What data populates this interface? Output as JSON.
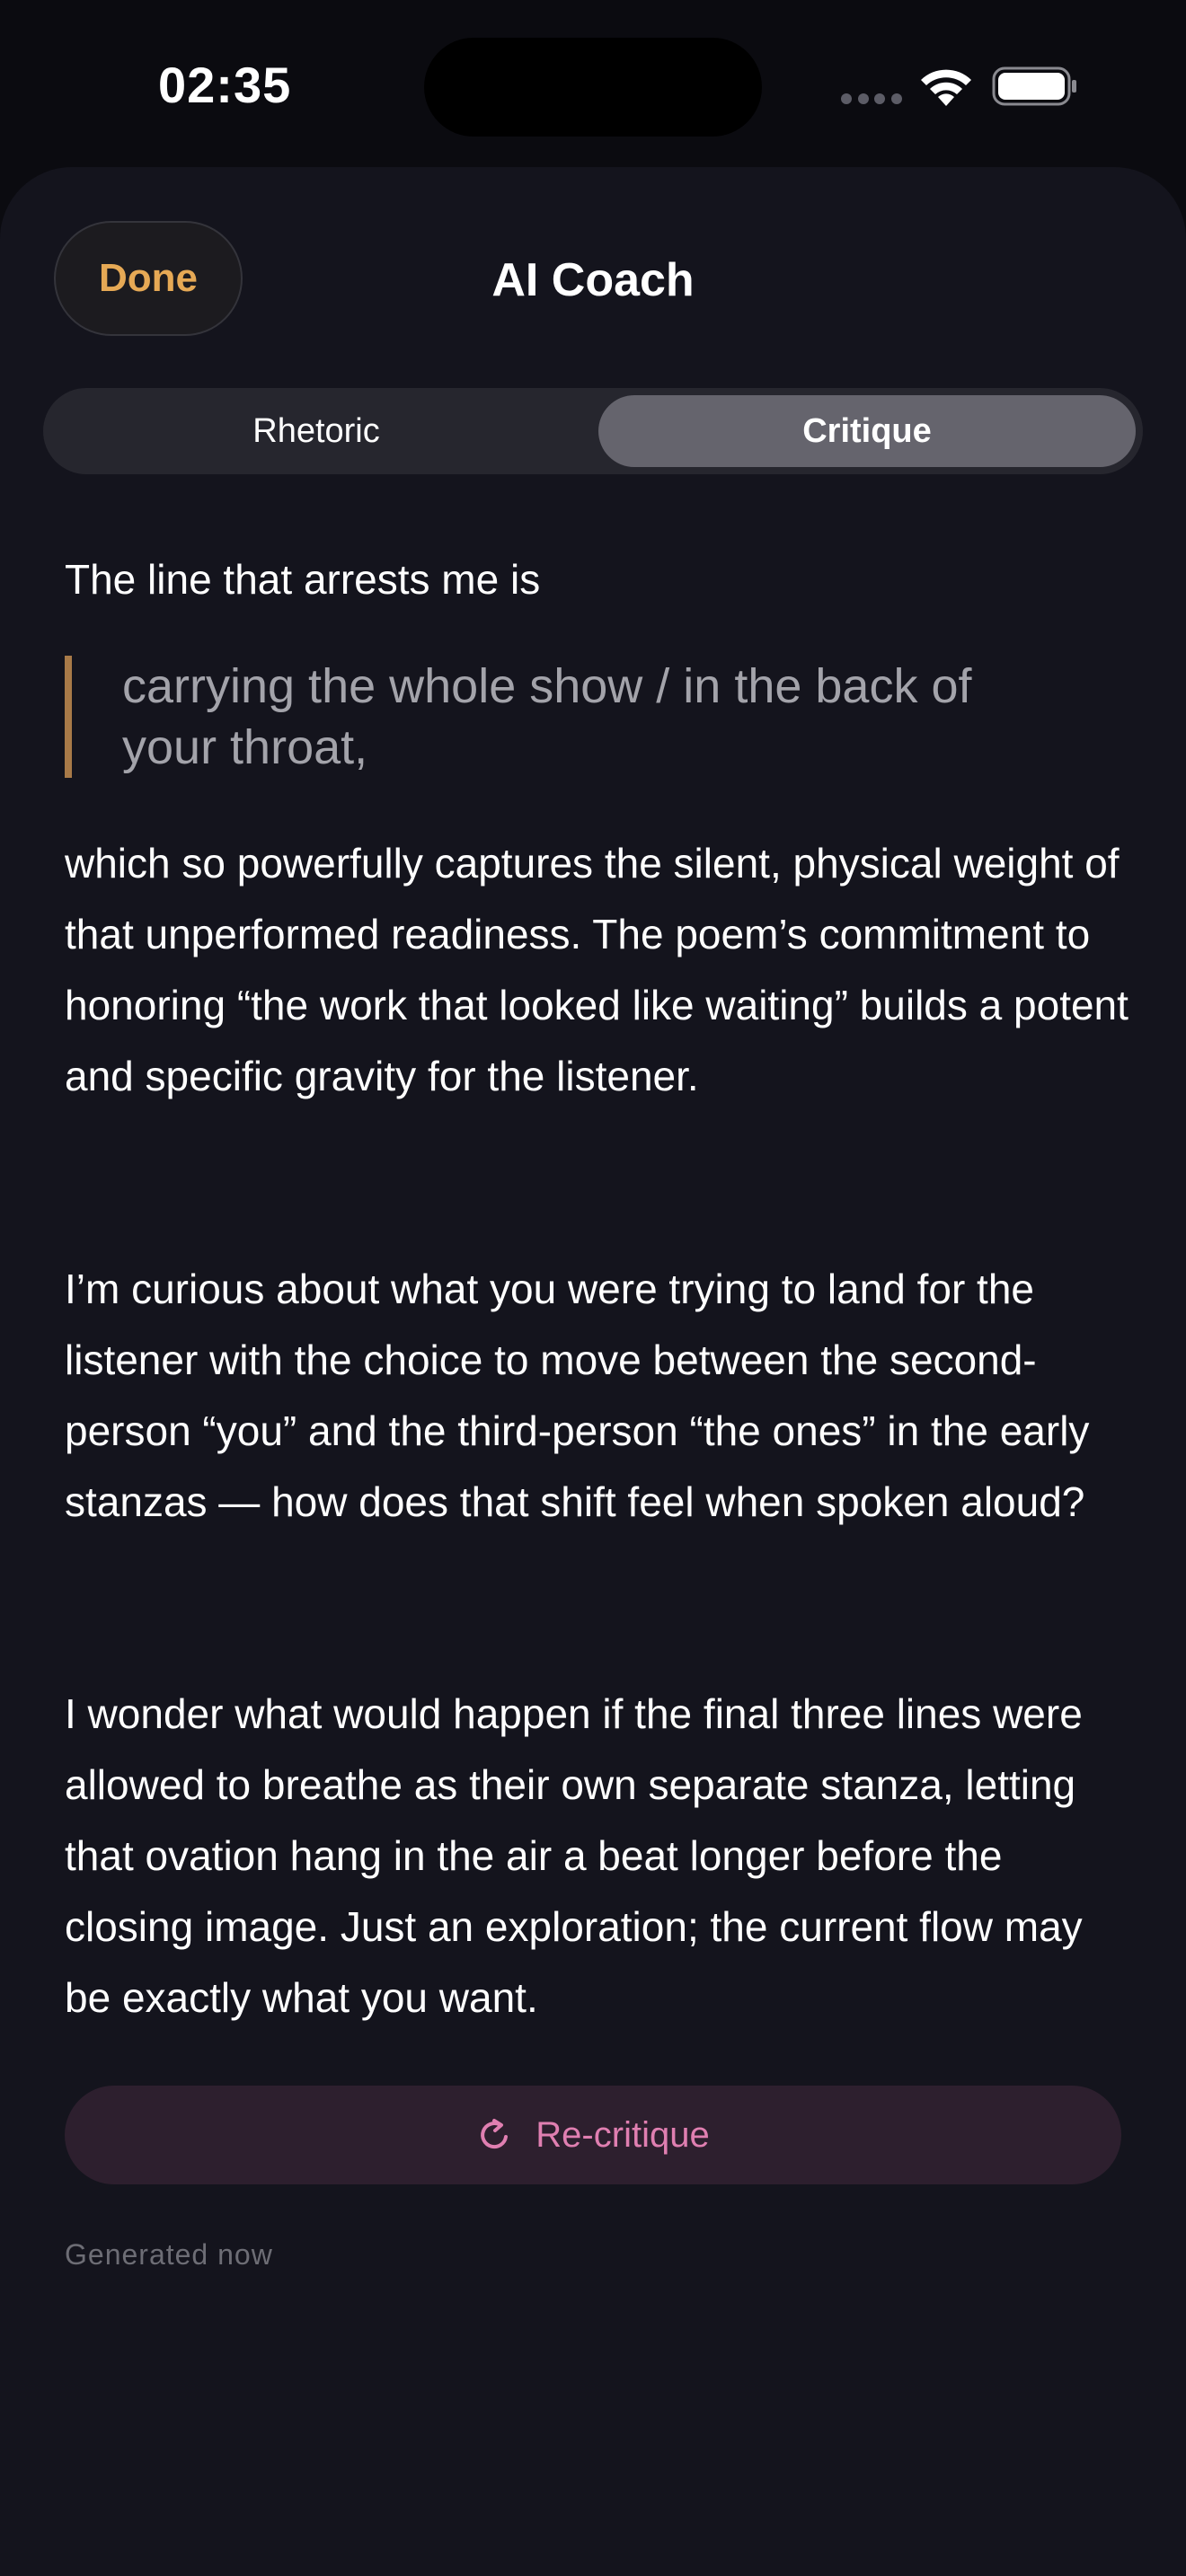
{
  "status_bar": {
    "time": "02:35"
  },
  "header": {
    "done_label": "Done",
    "title": "AI Coach"
  },
  "tabs": [
    {
      "label": "Rhetoric",
      "selected": false
    },
    {
      "label": "Critique",
      "selected": true
    }
  ],
  "critique": {
    "intro": "The line that arrests me is",
    "quote_line1": "carrying the whole show / in the back of",
    "quote_line2": "your throat,",
    "paragraph1": "which so powerfully captures the silent, physical weight of that unperformed readiness. The poem’s commitment to honoring “the work that looked like waiting” builds a potent and specific gravity for the listener.",
    "paragraph2": "I’m curious about what you were trying to land for the listener with the choice to move between the second-person “you” and the third-person “the ones” in the early stanzas — how does that shift feel when spoken aloud?",
    "paragraph3": "I wonder what would happen if the final three lines were allowed to breathe as their own separate stanza, letting that ovation hang in the air a beat longer before the closing image. Just an exploration; the current flow may be exactly what you want."
  },
  "actions": {
    "recritique_label": "Re-critique",
    "recritique_icon": "refresh-icon"
  },
  "footer": {
    "generated": "Generated now"
  },
  "colors": {
    "accent_done": "#e6a955",
    "accent_recritique": "#e07fb1",
    "quote_bar": "#a87a48",
    "sheet_background": "#14141d"
  }
}
